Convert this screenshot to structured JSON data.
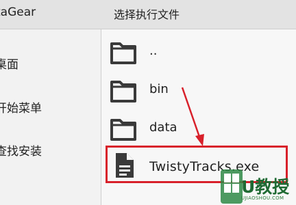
{
  "left_panel": {
    "title": "taGear",
    "items": [
      {
        "label": "桌面"
      },
      {
        "label": "开始菜单"
      },
      {
        "label": "查找安装"
      }
    ]
  },
  "file_chooser": {
    "title": "选择执行文件",
    "items": [
      {
        "name": "..",
        "type": "folder",
        "icon": "folder-icon"
      },
      {
        "name": "bin",
        "type": "folder",
        "icon": "folder-icon"
      },
      {
        "name": "data",
        "type": "folder",
        "icon": "folder-icon"
      },
      {
        "name": "TwistyTracks.exe",
        "type": "file",
        "icon": "file-icon"
      }
    ]
  },
  "annotation": {
    "highlight_color": "#d8202a",
    "arrow_color": "#d8202a"
  },
  "watermark": {
    "main": "U教授",
    "sub": "UJIAOSHOU.COM"
  }
}
